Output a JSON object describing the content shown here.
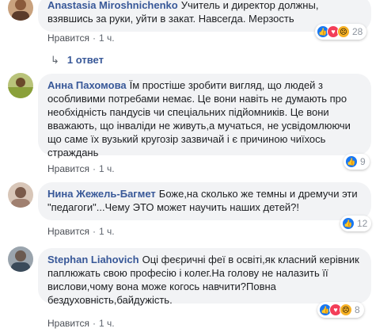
{
  "comments": [
    {
      "author": "Anastasia Miroshnichenko",
      "text": "Учитель и директор должны, взявшись за руки, уйти в закат. Навсегда. Мерзость",
      "like_label": "Нравится",
      "time": "1 ч.",
      "reaction_count": "28",
      "reactions": [
        "like-icon",
        "love-icon",
        "sad-icon"
      ],
      "replies_label": "1 ответ"
    },
    {
      "author": "Анна Пахомова",
      "text": "Їм простіше зробити вигляд, що людей з особливими потребами немає. Це вони навіть не думають про необхідність пандусів чи спеціальних підйомників. Це вони вважають, що інваліди не живуть,а мучаться, не усвідомлюючи що саме їх вузький кругозір зазвичай і є причиною чиїхось страждань",
      "like_label": "Нравится",
      "time": "1 ч.",
      "reaction_count": "9",
      "reactions": [
        "like-icon"
      ]
    },
    {
      "author": "Нина Жежель-Багмет",
      "text": "Боже,на сколько же темны и дремучи эти \"педагоги\"...Чему ЭТО может научить наших детей?!",
      "like_label": "Нравится",
      "time": "1 ч.",
      "reaction_count": "12",
      "reactions": [
        "like-icon"
      ]
    },
    {
      "author": "Stephan Liahovich",
      "text": "Оці феєричні феї в освіті,як класний керівник паплюжать свою професію і колег.На голову не налазить її вислови,чому вона може когось навчити?Повна бездуховність,байдужість.",
      "like_label": "Нравится",
      "time": "1 ч.",
      "reaction_count": "8",
      "reactions": [
        "like-icon",
        "love-icon",
        "sad-icon"
      ]
    }
  ],
  "colors": {
    "author": "#385898",
    "bubble": "#f2f3f5",
    "like": "#1877f2",
    "love": "#f33e58",
    "sad": "#f7b125"
  }
}
